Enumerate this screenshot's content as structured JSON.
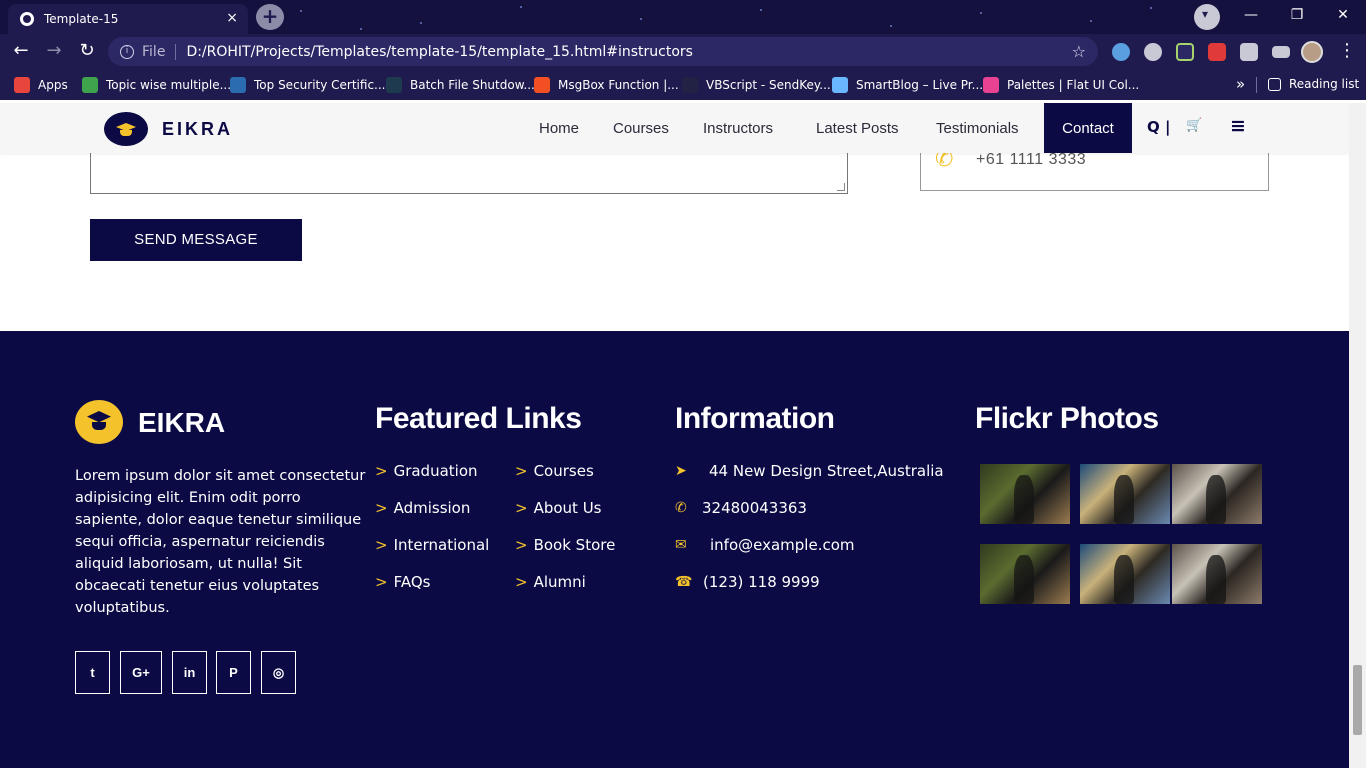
{
  "browser": {
    "tab_title": "Template-15",
    "tab_close": "×",
    "new_tab": "+",
    "omnibox_file": "File",
    "url": "D:/ROHIT/Projects/Templates/template-15/template_15.html#instructors",
    "win_min": "—",
    "win_restore": "❐",
    "win_close": "✕",
    "back": "←",
    "forward": "→",
    "reload": "↻",
    "bookmark_star": "☆",
    "menu_dots": "⋮",
    "bookmarks": [
      {
        "label": "Apps",
        "color": "#e8453c"
      },
      {
        "label": "Topic wise multiple...",
        "color": "#3fa34d"
      },
      {
        "label": "Top Security Certific...",
        "color": "#2b6cb0"
      },
      {
        "label": "Batch File Shutdow...",
        "color": "#1d3a4f"
      },
      {
        "label": "MsgBox Function |...",
        "color": "#f25022"
      },
      {
        "label": "VBScript - SendKey...",
        "color": "#222244"
      },
      {
        "label": "SmartBlog – Live Pr...",
        "color": "#6ab7ff"
      },
      {
        "label": "Palettes | Flat UI Col...",
        "color": "#e84393"
      }
    ],
    "bookmarks_more": "»",
    "reading_list": "Reading list"
  },
  "site": {
    "brand": "EIKRA",
    "nav": [
      "Home",
      "Courses",
      "Instructors",
      "Latest Posts",
      "Testimonials",
      "Contact"
    ],
    "active_nav": "Contact",
    "search_icon": "search-icon",
    "cart_icon": "cart-icon",
    "menu_icon": "hamburger-icon",
    "search_glyph": "Q |",
    "cart_glyph": "🛒",
    "menu_glyph": "≡"
  },
  "contact": {
    "send_label": "SEND MESSAGE",
    "phone": "+61 1111 3333"
  },
  "footer": {
    "brand": "EIKRA",
    "about": "Lorem ipsum dolor sit amet consectetur adipisicing elit. Enim odit porro sapiente, dolor eaque tenetur similique sequi officia, aspernatur reiciendis aliquid laboriosam, ut nulla! Sit obcaecati tenetur eius voluptates voluptatibus.",
    "social": [
      "twitter",
      "google-plus",
      "linkedin",
      "pinterest",
      "instagram"
    ],
    "social_glyphs": [
      "t",
      "G+",
      "in",
      "P",
      "◎"
    ],
    "featured_title": "Featured Links",
    "links_col1": [
      "Graduation",
      "Admission",
      "International",
      "FAQs"
    ],
    "links_col2": [
      "Courses",
      "About Us",
      "Book Store",
      "Alumni"
    ],
    "link_prefix": ">",
    "info_title": "Information",
    "info": [
      {
        "icon": "paper-plane-icon",
        "glyph": "➤",
        "text": "44 New Design Street,Australia"
      },
      {
        "icon": "phone-icon",
        "glyph": "✆",
        "text": "32480043363"
      },
      {
        "icon": "envelope-icon",
        "glyph": "✉",
        "text": "info@example.com"
      },
      {
        "icon": "phone-square-icon",
        "glyph": "☎",
        "text": "(123) 118 9999"
      }
    ],
    "flickr_title": "Flickr Photos"
  },
  "colors": {
    "navy": "#0b0a45",
    "accent": "#f4c22b"
  }
}
